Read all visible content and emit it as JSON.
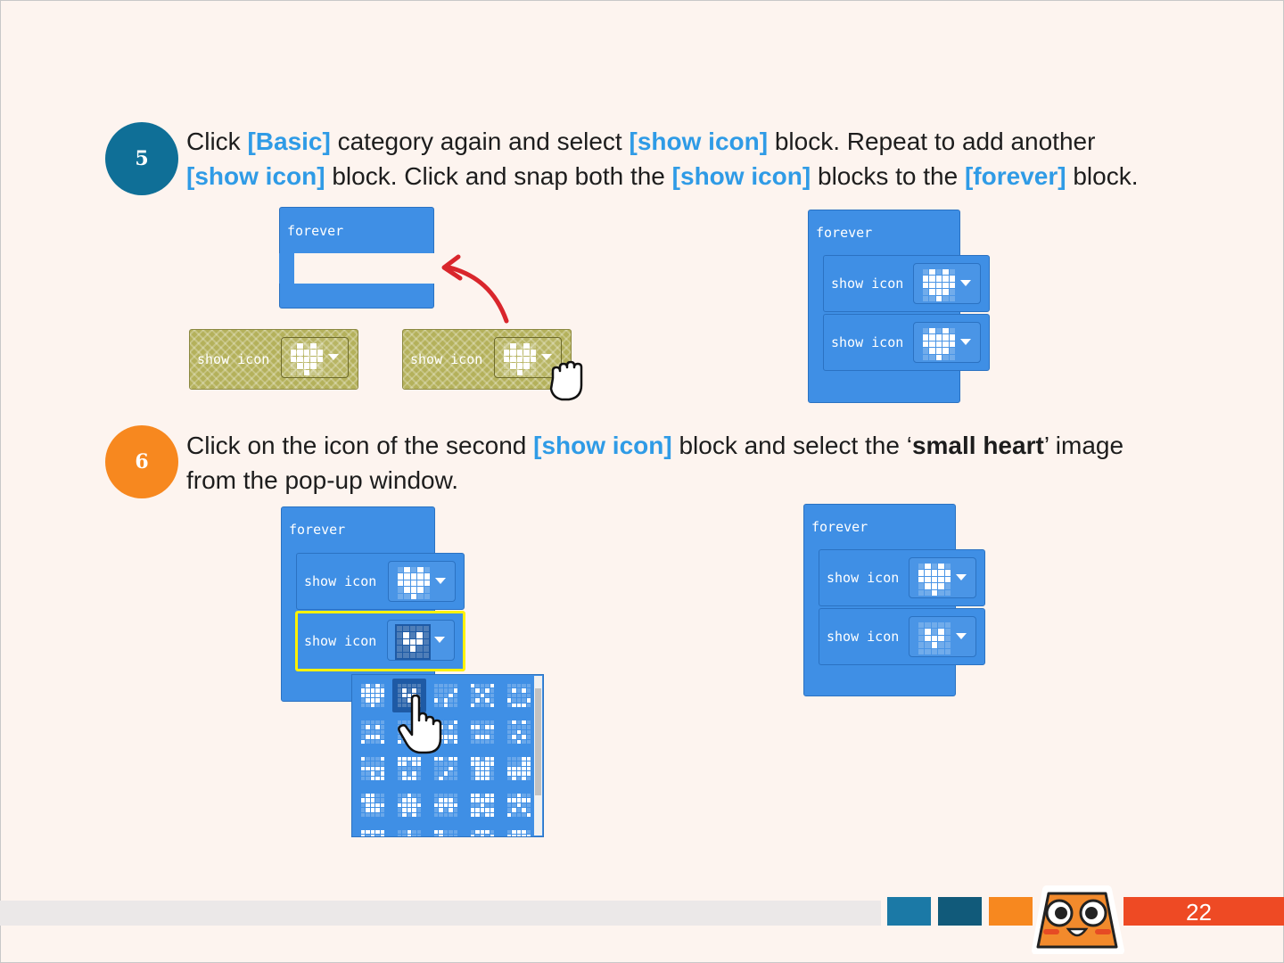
{
  "page_number": "22",
  "steps": [
    {
      "number": "5",
      "color": "#0f6f97",
      "line1": {
        "p1": "Click ",
        "h1": "[Basic]",
        "p2": " category again and select ",
        "h2": "[show icon]",
        "p3": " block. Repeat to add another"
      },
      "line2": {
        "h1": "[show icon]",
        "p1": " block. Click and snap both the ",
        "h2": "[show icon]",
        "p2": " blocks to the ",
        "h3": "[forever]",
        "p3": " block."
      }
    },
    {
      "number": "6",
      "color": "#f7881f",
      "line1": {
        "p1": "Click on the icon of the second ",
        "h1": "[show icon]",
        "p2": " block and select the ‘",
        "b1": "small heart",
        "p3": "’ image"
      },
      "line2": {
        "p1": "from the pop-up window."
      }
    }
  ],
  "blocks": {
    "forever_label": "forever",
    "show_icon_label": "show icon"
  },
  "icons": {
    "hand_pointer": "hand-pointer-icon",
    "hand_grab": "hand-grab-icon",
    "arrow": "red-curved-arrow",
    "dropdown": "dropdown-caret-icon"
  },
  "colors": {
    "block_blue": "#3f8fe5",
    "drag_olive": "#b4b15b",
    "highlight_text": "#2f9be6",
    "selection_yellow": "#fff200",
    "page_tab": "#ee4a24"
  }
}
